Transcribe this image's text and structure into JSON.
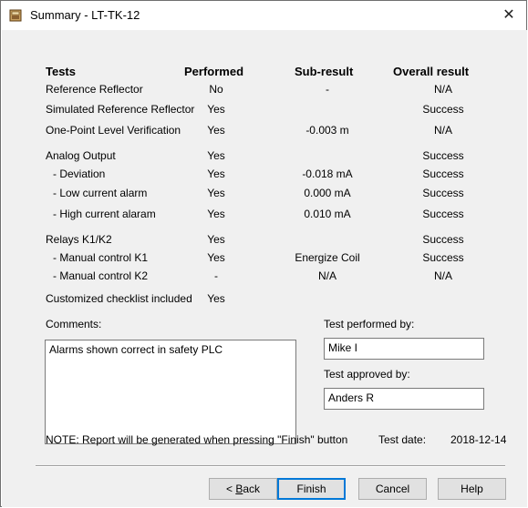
{
  "window": {
    "title": "Summary - LT-TK-12",
    "close_glyph": "✕"
  },
  "headers": {
    "tests": "Tests",
    "performed": "Performed",
    "sub_result": "Sub-result",
    "overall": "Overall result"
  },
  "rows": [
    {
      "test": "Reference Reflector",
      "performed": "No",
      "sub": "-",
      "overall": "N/A"
    },
    {
      "test": "Simulated Reference Reflector",
      "performed": "Yes",
      "sub": "",
      "overall": "Success"
    },
    {
      "test": "One-Point Level Verification",
      "performed": "Yes",
      "sub": "-0.003  m",
      "overall": "N/A"
    },
    {
      "test": "Analog Output",
      "performed": "Yes",
      "sub": "",
      "overall": "Success"
    },
    {
      "test": "- Deviation",
      "performed": "Yes",
      "sub": "-0.018  mA",
      "overall": "Success"
    },
    {
      "test": "- Low current alarm",
      "performed": "Yes",
      "sub": "0.000  mA",
      "overall": "Success"
    },
    {
      "test": "- High current alaram",
      "performed": "Yes",
      "sub": "0.010  mA",
      "overall": "Success"
    },
    {
      "test": "Relays K1/K2",
      "performed": "Yes",
      "sub": "",
      "overall": "Success"
    },
    {
      "test": "- Manual control K1",
      "performed": "Yes",
      "sub": "Energize Coil",
      "overall": "Success"
    },
    {
      "test": "- Manual control K2",
      "performed": "-",
      "sub": "N/A",
      "overall": "N/A"
    },
    {
      "test": "Customized checklist included",
      "performed": "Yes",
      "sub": "",
      "overall": ""
    }
  ],
  "comments": {
    "label": "Comments:",
    "value": "Alarms shown correct in safety PLC"
  },
  "performed_by": {
    "label": "Test performed by:",
    "value": "Mike I"
  },
  "approved_by": {
    "label": "Test approved by:",
    "value": "Anders R"
  },
  "note": "NOTE: Report will be generated when pressing \"Finish\" button",
  "test_date": {
    "label": "Test date:",
    "value": "2018-12-14"
  },
  "buttons": {
    "back_mnemonic": "B",
    "back_rest": "ack",
    "back_prefix": "< ",
    "finish": "Finish",
    "cancel": "Cancel",
    "help": "Help"
  },
  "colors": {
    "dialog_bg": "#f0f0f0",
    "default_button_border": "#0078d7"
  }
}
